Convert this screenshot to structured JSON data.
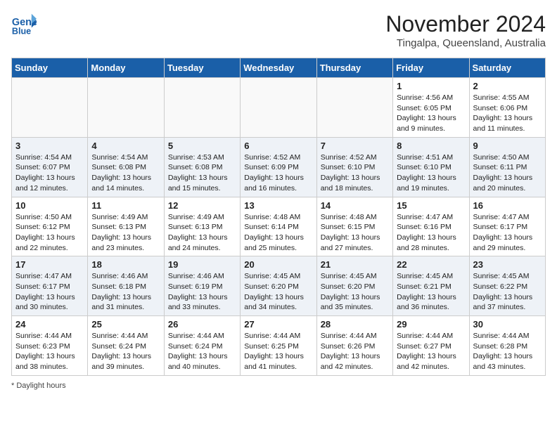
{
  "header": {
    "logo_line1": "General",
    "logo_line2": "Blue",
    "month_year": "November 2024",
    "location": "Tingalpa, Queensland, Australia"
  },
  "days_of_week": [
    "Sunday",
    "Monday",
    "Tuesday",
    "Wednesday",
    "Thursday",
    "Friday",
    "Saturday"
  ],
  "weeks": [
    [
      {
        "day": "",
        "info": "",
        "empty": true
      },
      {
        "day": "",
        "info": "",
        "empty": true
      },
      {
        "day": "",
        "info": "",
        "empty": true
      },
      {
        "day": "",
        "info": "",
        "empty": true
      },
      {
        "day": "",
        "info": "",
        "empty": true
      },
      {
        "day": "1",
        "info": "Sunrise: 4:56 AM\nSunset: 6:05 PM\nDaylight: 13 hours\nand 9 minutes."
      },
      {
        "day": "2",
        "info": "Sunrise: 4:55 AM\nSunset: 6:06 PM\nDaylight: 13 hours\nand 11 minutes."
      }
    ],
    [
      {
        "day": "3",
        "info": "Sunrise: 4:54 AM\nSunset: 6:07 PM\nDaylight: 13 hours\nand 12 minutes."
      },
      {
        "day": "4",
        "info": "Sunrise: 4:54 AM\nSunset: 6:08 PM\nDaylight: 13 hours\nand 14 minutes."
      },
      {
        "day": "5",
        "info": "Sunrise: 4:53 AM\nSunset: 6:08 PM\nDaylight: 13 hours\nand 15 minutes."
      },
      {
        "day": "6",
        "info": "Sunrise: 4:52 AM\nSunset: 6:09 PM\nDaylight: 13 hours\nand 16 minutes."
      },
      {
        "day": "7",
        "info": "Sunrise: 4:52 AM\nSunset: 6:10 PM\nDaylight: 13 hours\nand 18 minutes."
      },
      {
        "day": "8",
        "info": "Sunrise: 4:51 AM\nSunset: 6:10 PM\nDaylight: 13 hours\nand 19 minutes."
      },
      {
        "day": "9",
        "info": "Sunrise: 4:50 AM\nSunset: 6:11 PM\nDaylight: 13 hours\nand 20 minutes."
      }
    ],
    [
      {
        "day": "10",
        "info": "Sunrise: 4:50 AM\nSunset: 6:12 PM\nDaylight: 13 hours\nand 22 minutes."
      },
      {
        "day": "11",
        "info": "Sunrise: 4:49 AM\nSunset: 6:13 PM\nDaylight: 13 hours\nand 23 minutes."
      },
      {
        "day": "12",
        "info": "Sunrise: 4:49 AM\nSunset: 6:13 PM\nDaylight: 13 hours\nand 24 minutes."
      },
      {
        "day": "13",
        "info": "Sunrise: 4:48 AM\nSunset: 6:14 PM\nDaylight: 13 hours\nand 25 minutes."
      },
      {
        "day": "14",
        "info": "Sunrise: 4:48 AM\nSunset: 6:15 PM\nDaylight: 13 hours\nand 27 minutes."
      },
      {
        "day": "15",
        "info": "Sunrise: 4:47 AM\nSunset: 6:16 PM\nDaylight: 13 hours\nand 28 minutes."
      },
      {
        "day": "16",
        "info": "Sunrise: 4:47 AM\nSunset: 6:17 PM\nDaylight: 13 hours\nand 29 minutes."
      }
    ],
    [
      {
        "day": "17",
        "info": "Sunrise: 4:47 AM\nSunset: 6:17 PM\nDaylight: 13 hours\nand 30 minutes."
      },
      {
        "day": "18",
        "info": "Sunrise: 4:46 AM\nSunset: 6:18 PM\nDaylight: 13 hours\nand 31 minutes."
      },
      {
        "day": "19",
        "info": "Sunrise: 4:46 AM\nSunset: 6:19 PM\nDaylight: 13 hours\nand 33 minutes."
      },
      {
        "day": "20",
        "info": "Sunrise: 4:45 AM\nSunset: 6:20 PM\nDaylight: 13 hours\nand 34 minutes."
      },
      {
        "day": "21",
        "info": "Sunrise: 4:45 AM\nSunset: 6:20 PM\nDaylight: 13 hours\nand 35 minutes."
      },
      {
        "day": "22",
        "info": "Sunrise: 4:45 AM\nSunset: 6:21 PM\nDaylight: 13 hours\nand 36 minutes."
      },
      {
        "day": "23",
        "info": "Sunrise: 4:45 AM\nSunset: 6:22 PM\nDaylight: 13 hours\nand 37 minutes."
      }
    ],
    [
      {
        "day": "24",
        "info": "Sunrise: 4:44 AM\nSunset: 6:23 PM\nDaylight: 13 hours\nand 38 minutes."
      },
      {
        "day": "25",
        "info": "Sunrise: 4:44 AM\nSunset: 6:24 PM\nDaylight: 13 hours\nand 39 minutes."
      },
      {
        "day": "26",
        "info": "Sunrise: 4:44 AM\nSunset: 6:24 PM\nDaylight: 13 hours\nand 40 minutes."
      },
      {
        "day": "27",
        "info": "Sunrise: 4:44 AM\nSunset: 6:25 PM\nDaylight: 13 hours\nand 41 minutes."
      },
      {
        "day": "28",
        "info": "Sunrise: 4:44 AM\nSunset: 6:26 PM\nDaylight: 13 hours\nand 42 minutes."
      },
      {
        "day": "29",
        "info": "Sunrise: 4:44 AM\nSunset: 6:27 PM\nDaylight: 13 hours\nand 42 minutes."
      },
      {
        "day": "30",
        "info": "Sunrise: 4:44 AM\nSunset: 6:28 PM\nDaylight: 13 hours\nand 43 minutes."
      }
    ]
  ],
  "footer": {
    "daylight_label": "Daylight hours"
  },
  "colors": {
    "header_bg": "#1a5fa8",
    "row_even": "#eef2f7",
    "row_odd": "#ffffff"
  }
}
